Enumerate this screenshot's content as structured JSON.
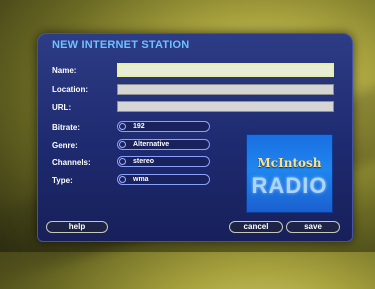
{
  "dialog": {
    "title": "NEW INTERNET STATION"
  },
  "fields": {
    "name": {
      "label": "Name:",
      "value": ""
    },
    "location": {
      "label": "Location:",
      "value": ""
    },
    "url": {
      "label": "URL:",
      "value": ""
    }
  },
  "selectors": {
    "bitrate": {
      "label": "Bitrate:",
      "value": "192"
    },
    "genre": {
      "label": "Genre:",
      "value": "Alternative"
    },
    "channels": {
      "label": "Channels:",
      "value": "stereo"
    },
    "type": {
      "label": "Type:",
      "value": "wma"
    }
  },
  "logo": {
    "brand": "McIntosh",
    "text": "RADIO"
  },
  "buttons": {
    "help": "help",
    "cancel": "cancel",
    "save": "save"
  },
  "colors": {
    "title_accent": "#6ec0ff",
    "dialog_bg": "#1e2a6f",
    "logo_blue": "#1f86ef"
  }
}
